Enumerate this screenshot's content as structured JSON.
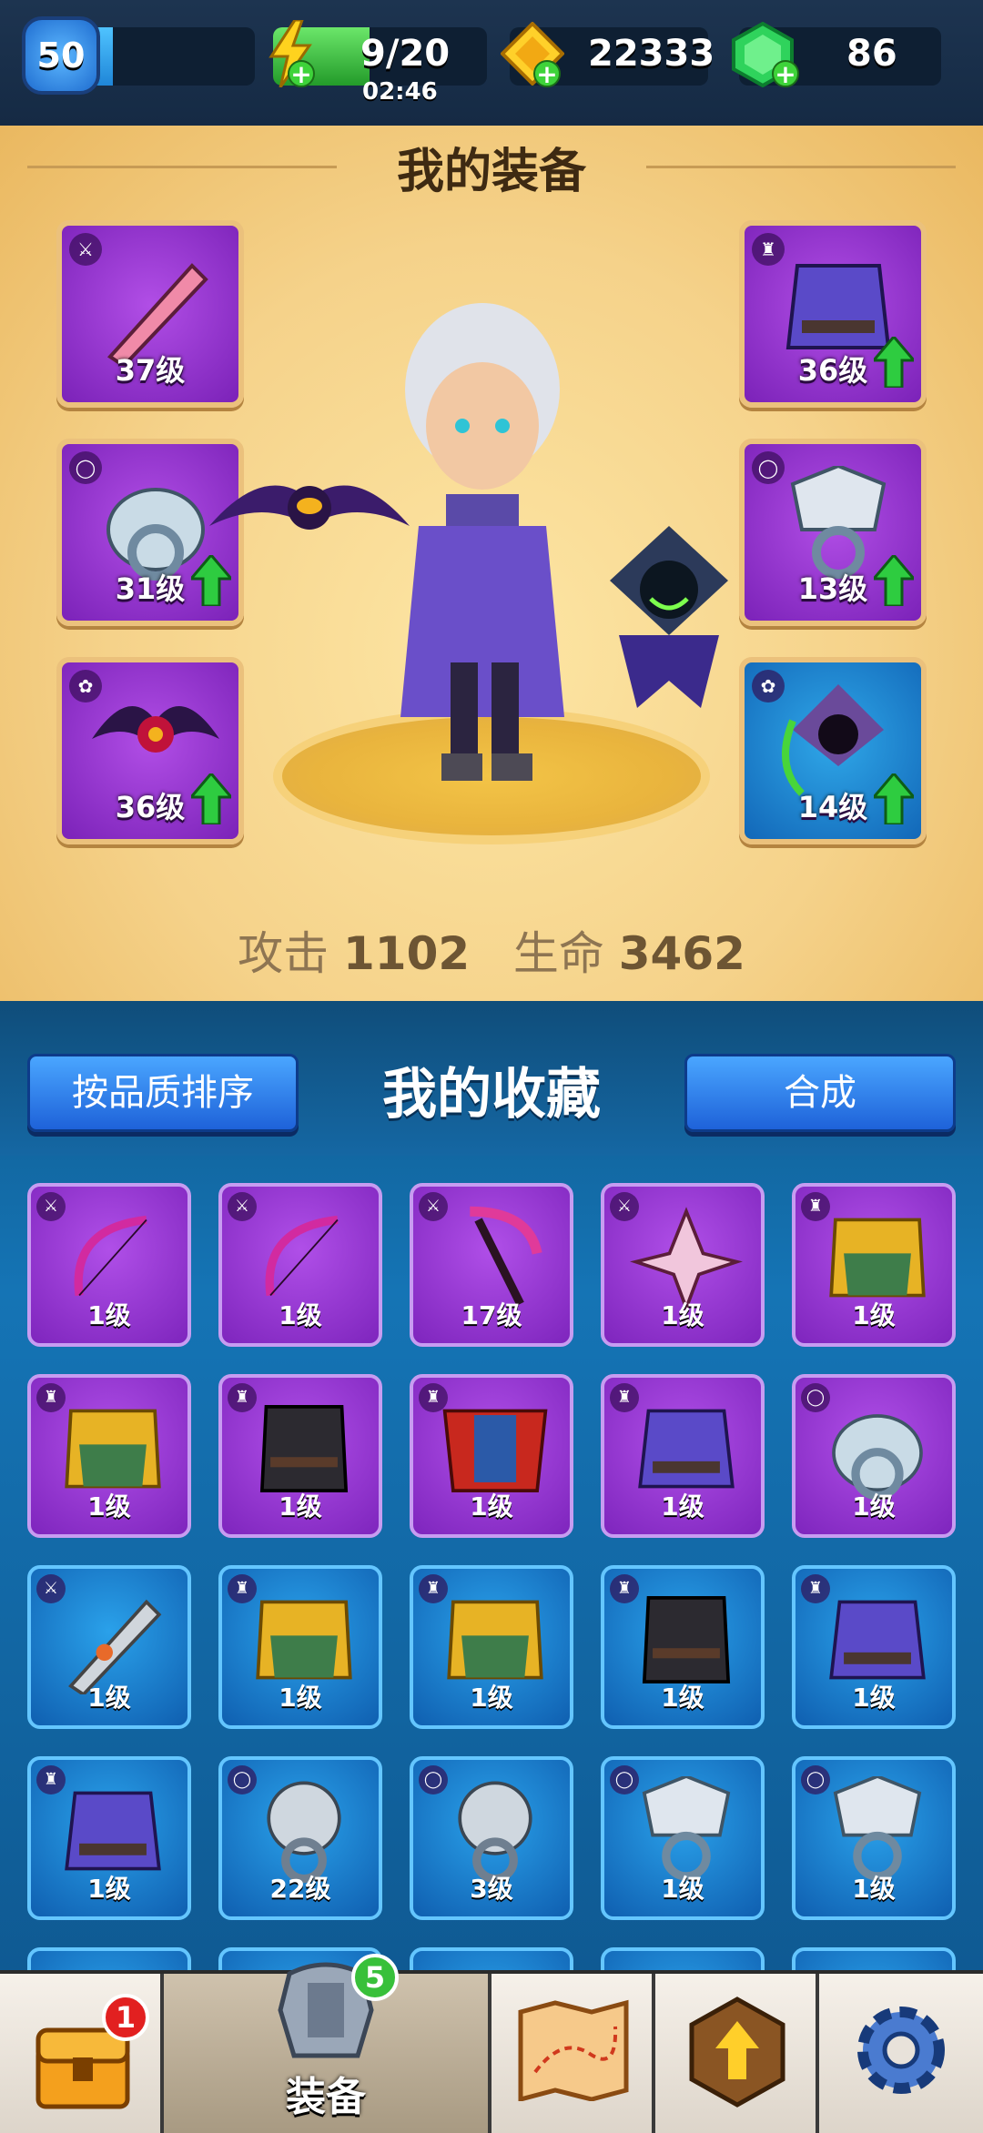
{
  "topbar": {
    "player_level": "50",
    "level_progress": 0.35,
    "energy": "9/20",
    "energy_timer": "02:46",
    "energy_progress": 0.45,
    "gold": "22333",
    "gems": "86"
  },
  "equipment": {
    "title": "我的装备",
    "left_slots": [
      {
        "level": "37级",
        "type": "weapon",
        "icon": "pink-sword-icon",
        "upgrade": false
      },
      {
        "level": "31级",
        "type": "ring",
        "icon": "dragon-ring-icon",
        "upgrade": true
      },
      {
        "level": "36级",
        "type": "pet",
        "icon": "bat-pet-icon",
        "upgrade": true
      }
    ],
    "right_slots": [
      {
        "level": "36级",
        "type": "armor",
        "icon": "purple-robe-icon",
        "upgrade": true
      },
      {
        "level": "13级",
        "type": "ring",
        "icon": "wolf-ring-icon",
        "upgrade": true
      },
      {
        "level": "14级",
        "type": "pet",
        "icon": "reaper-pet-icon",
        "upgrade": true
      }
    ],
    "attack_label": "攻击",
    "attack_value": "1102",
    "hp_label": "生命",
    "hp_value": "3462"
  },
  "collection": {
    "title": "我的收藏",
    "sort_button": "按品质排序",
    "merge_button": "合成",
    "items": [
      {
        "level": "1级",
        "rarity": "purple",
        "type": "weapon",
        "icon": "bow-icon"
      },
      {
        "level": "1级",
        "rarity": "purple",
        "type": "weapon",
        "icon": "bow-icon"
      },
      {
        "level": "17级",
        "rarity": "purple",
        "type": "weapon",
        "icon": "scythe-icon"
      },
      {
        "level": "1级",
        "rarity": "purple",
        "type": "weapon",
        "icon": "shuriken-icon"
      },
      {
        "level": "1级",
        "rarity": "purple",
        "type": "armor",
        "icon": "gold-armor-icon"
      },
      {
        "level": "1级",
        "rarity": "purple",
        "type": "armor",
        "icon": "gold-armor-icon"
      },
      {
        "level": "1级",
        "rarity": "purple",
        "type": "armor",
        "icon": "dark-vest-icon"
      },
      {
        "level": "1级",
        "rarity": "purple",
        "type": "armor",
        "icon": "red-cape-icon"
      },
      {
        "level": "1级",
        "rarity": "purple",
        "type": "armor",
        "icon": "purple-robe-icon"
      },
      {
        "level": "1级",
        "rarity": "purple",
        "type": "ring",
        "icon": "dragon-ring-icon"
      },
      {
        "level": "1级",
        "rarity": "blue",
        "type": "weapon",
        "icon": "sword-icon"
      },
      {
        "level": "1级",
        "rarity": "blue",
        "type": "armor",
        "icon": "gold-armor-icon"
      },
      {
        "level": "1级",
        "rarity": "blue",
        "type": "armor",
        "icon": "gold-armor-icon"
      },
      {
        "level": "1级",
        "rarity": "blue",
        "type": "armor",
        "icon": "dark-vest-icon"
      },
      {
        "level": "1级",
        "rarity": "blue",
        "type": "armor",
        "icon": "purple-robe-icon"
      },
      {
        "level": "1级",
        "rarity": "blue",
        "type": "armor",
        "icon": "purple-robe-icon"
      },
      {
        "level": "22级",
        "rarity": "blue",
        "type": "ring",
        "icon": "bear-ring-icon"
      },
      {
        "level": "3级",
        "rarity": "blue",
        "type": "ring",
        "icon": "bear-ring-icon"
      },
      {
        "level": "1级",
        "rarity": "blue",
        "type": "ring",
        "icon": "wolf-ring-icon"
      },
      {
        "level": "1级",
        "rarity": "blue",
        "type": "ring",
        "icon": "wolf-ring-icon"
      }
    ]
  },
  "navbar": {
    "chest_badge": "1",
    "equipment_label": "装备",
    "equipment_badge": "5",
    "tabs": [
      "chest-icon",
      "armor-icon",
      "map-icon",
      "upgrade-icon",
      "settings-icon"
    ]
  },
  "colors": {
    "purple_rarity": "#8a2fca",
    "blue_rarity": "#1673c2",
    "gold_background": "#f5d28a",
    "upgrade_green": "#2ecc40"
  }
}
